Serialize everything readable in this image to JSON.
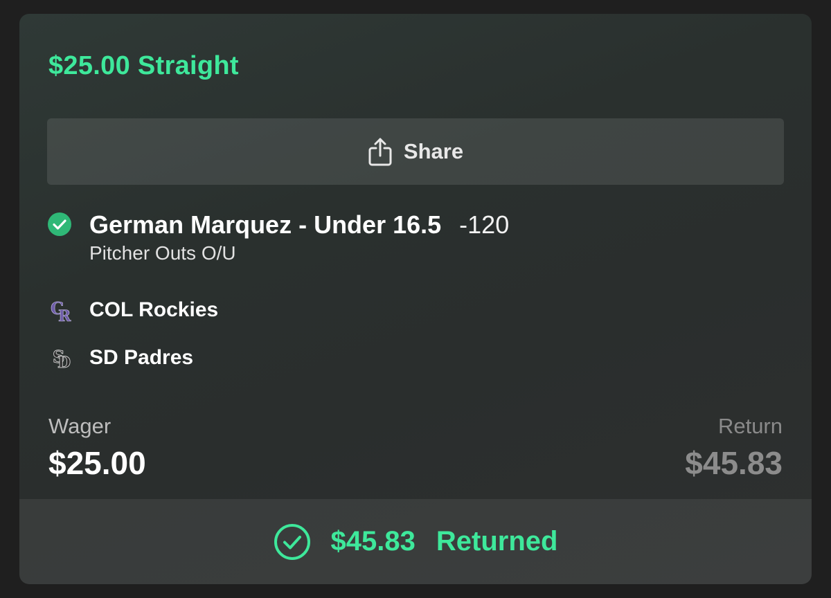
{
  "bet": {
    "title": "$25.00 Straight"
  },
  "share": {
    "label": "Share",
    "icon": "share-icon"
  },
  "leg": {
    "status_icon": "check-circle-icon",
    "selection": "German Marquez - Under 16.5",
    "odds": "-120",
    "market": "Pitcher Outs O/U"
  },
  "teams": [
    {
      "name": "COL Rockies",
      "logo": "rockies-logo-icon"
    },
    {
      "name": "SD Padres",
      "logo": "padres-logo-icon"
    }
  ],
  "wager": {
    "label": "Wager",
    "value": "$25.00"
  },
  "return": {
    "label": "Return",
    "value": "$45.83"
  },
  "footer": {
    "status_icon": "check-circle-outline-icon",
    "amount": "$45.83",
    "status": "Returned"
  },
  "colors": {
    "accent": "#3ee89b",
    "card_bg": "#2c3331",
    "page_bg": "#1f1f1f"
  }
}
